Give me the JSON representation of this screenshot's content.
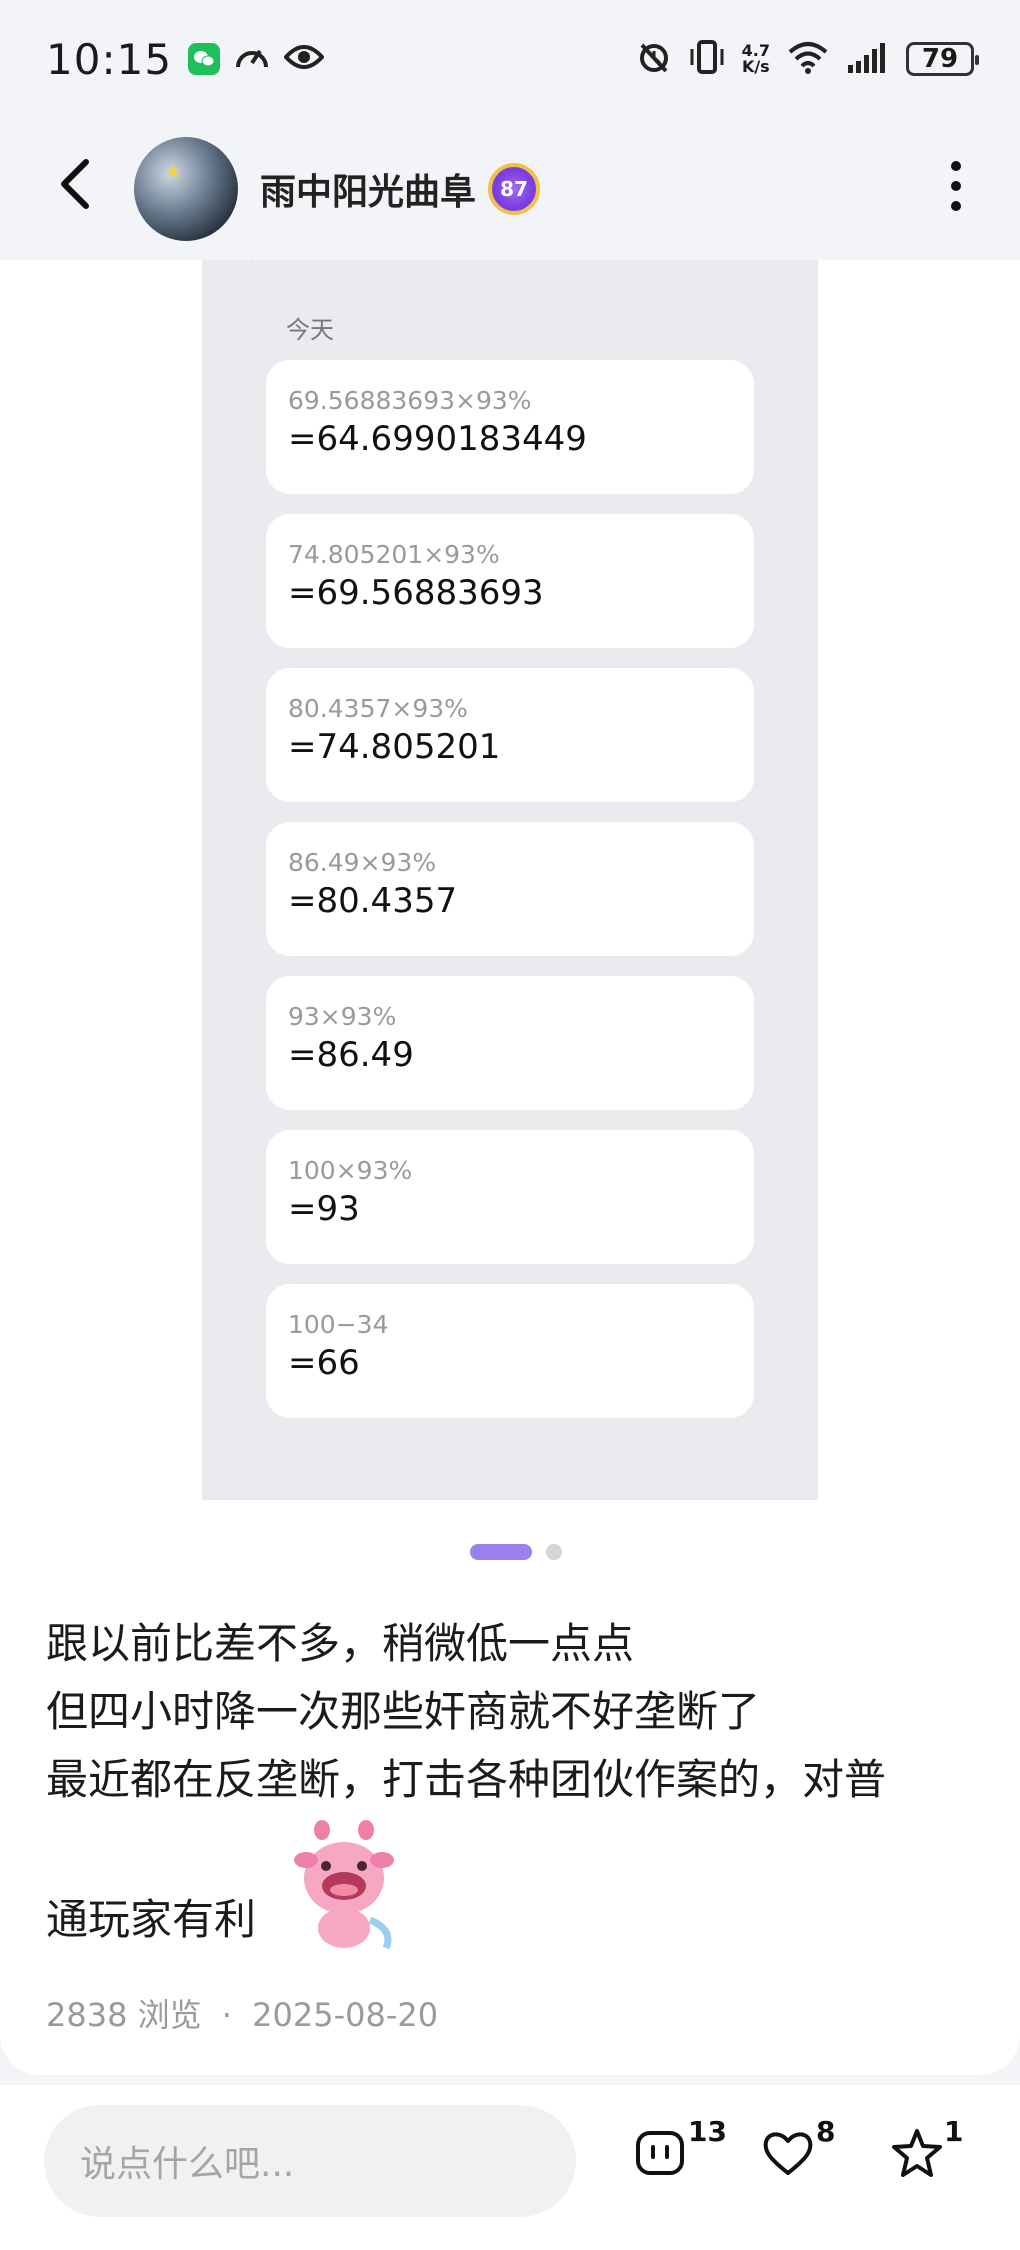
{
  "status_bar": {
    "time": "10:15",
    "net_speed_value": "4.7",
    "net_speed_unit": "K/s",
    "battery": "79"
  },
  "header": {
    "username": "雨中阳光曲阜",
    "level_badge": "87"
  },
  "calc_history": {
    "section_label": "今天",
    "records": [
      {
        "expr": "69.56883693×93%",
        "result": "=64.6990183449"
      },
      {
        "expr": "74.805201×93%",
        "result": "=69.56883693"
      },
      {
        "expr": "80.4357×93%",
        "result": "=74.805201"
      },
      {
        "expr": "86.49×93%",
        "result": "=80.4357"
      },
      {
        "expr": "93×93%",
        "result": "=86.49"
      },
      {
        "expr": "100×93%",
        "result": "=93"
      },
      {
        "expr": "100−34",
        "result": "=66"
      }
    ]
  },
  "post": {
    "line1": "跟以前比差不多，稍微低一点点",
    "line2": "但四小时降一次那些奸商就不好垄断了",
    "line3": "最近都在反垄断，打击各种团伙作案的，对普",
    "line4": "通玩家有利",
    "views": "2838 浏览",
    "separator": "·",
    "date": "2025-08-20"
  },
  "bottom_bar": {
    "comment_placeholder": "说点什么吧...",
    "comment_count": "13",
    "like_count": "8",
    "favorite_count": "1"
  },
  "colors": {
    "accent": "#9b80ee",
    "page_bg": "#f2f4f8",
    "screenshot_bg": "#e9ebef"
  },
  "icons": [
    "wechat-icon",
    "speed-icon",
    "eye-icon",
    "alarm-icon",
    "vibrate-icon",
    "wifi-icon",
    "signal-icon",
    "battery-icon",
    "back-icon",
    "more-icon",
    "comment-icon",
    "heart-icon",
    "star-icon"
  ]
}
